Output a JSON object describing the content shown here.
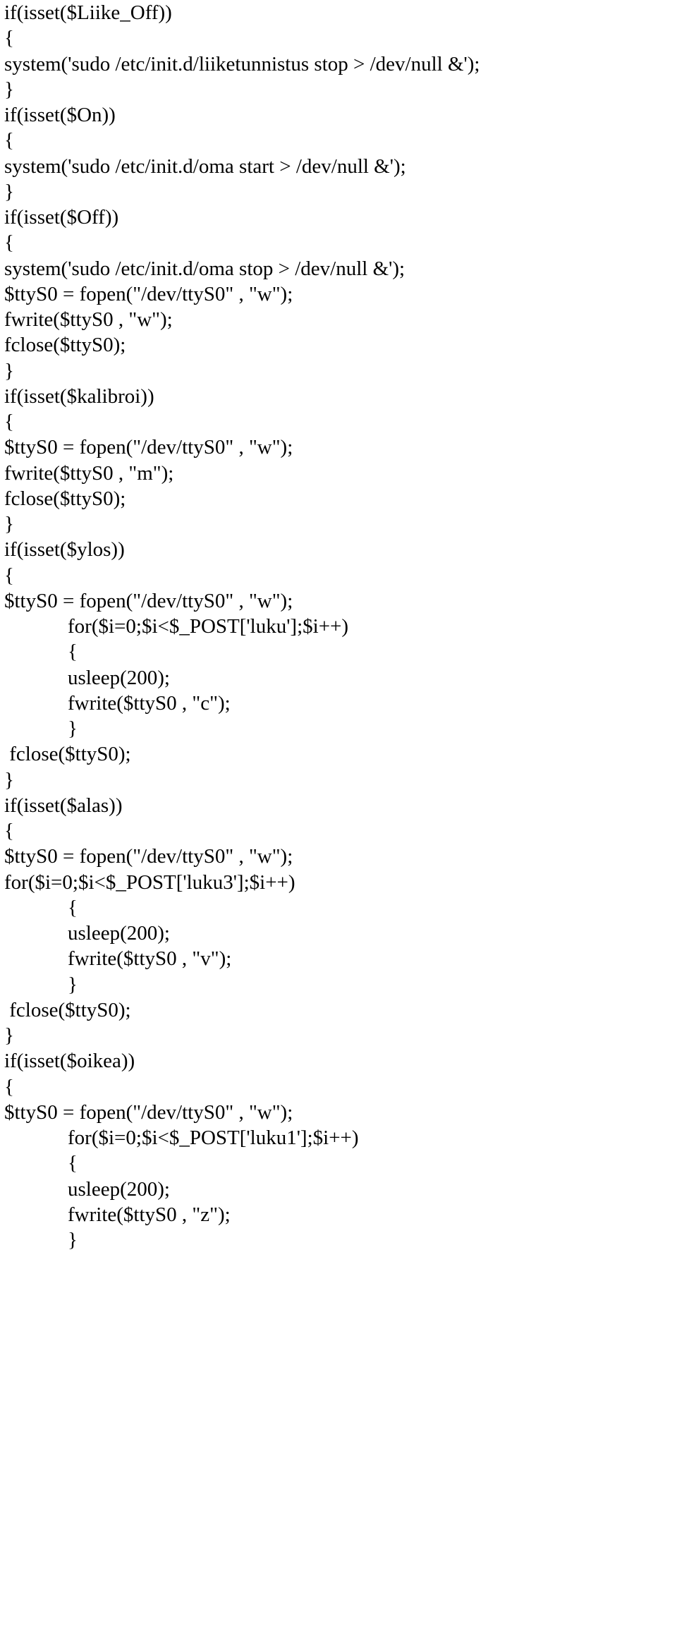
{
  "lines": [
    {
      "indent": 0,
      "text": "if(isset($Liike_Off))"
    },
    {
      "indent": 0,
      "text": "{"
    },
    {
      "indent": 0,
      "text": "system('sudo /etc/init.d/liiketunnistus stop > /dev/null &');"
    },
    {
      "indent": 0,
      "text": "}"
    },
    {
      "indent": 0,
      "text": "if(isset($On))"
    },
    {
      "indent": 0,
      "text": "{"
    },
    {
      "indent": 0,
      "text": "system('sudo /etc/init.d/oma start > /dev/null &');"
    },
    {
      "indent": 0,
      "text": "}"
    },
    {
      "indent": 0,
      "text": "if(isset($Off))"
    },
    {
      "indent": 0,
      "text": "{"
    },
    {
      "indent": 0,
      "text": "system('sudo /etc/init.d/oma stop > /dev/null &');"
    },
    {
      "indent": 0,
      "text": "$ttyS0 = fopen(\"/dev/ttyS0\" , \"w\");"
    },
    {
      "indent": 0,
      "text": "fwrite($ttyS0 , \"w\");"
    },
    {
      "indent": 0,
      "text": "fclose($ttyS0);"
    },
    {
      "indent": 0,
      "text": "}"
    },
    {
      "indent": 0,
      "text": "if(isset($kalibroi))"
    },
    {
      "indent": 0,
      "text": "{"
    },
    {
      "indent": 0,
      "text": "$ttyS0 = fopen(\"/dev/ttyS0\" , \"w\");"
    },
    {
      "indent": 0,
      "text": "fwrite($ttyS0 , \"m\");"
    },
    {
      "indent": 0,
      "text": "fclose($ttyS0);"
    },
    {
      "indent": 0,
      "text": "}"
    },
    {
      "indent": 0,
      "text": "if(isset($ylos))"
    },
    {
      "indent": 0,
      "text": "{"
    },
    {
      "indent": 0,
      "text": "$ttyS0 = fopen(\"/dev/ttyS0\" , \"w\");"
    },
    {
      "indent": 1,
      "text": "for($i=0;$i<$_POST['luku'];$i++)"
    },
    {
      "indent": 1,
      "text": "{"
    },
    {
      "indent": 1,
      "text": "usleep(200);"
    },
    {
      "indent": 1,
      "text": "fwrite($ttyS0 , \"c\");"
    },
    {
      "indent": 1,
      "text": "}"
    },
    {
      "indent": 0,
      "text": " fclose($ttyS0);"
    },
    {
      "indent": 0,
      "text": "}"
    },
    {
      "indent": 0,
      "text": "if(isset($alas))"
    },
    {
      "indent": 0,
      "text": "{"
    },
    {
      "indent": 0,
      "text": "$ttyS0 = fopen(\"/dev/ttyS0\" , \"w\");"
    },
    {
      "indent": 0,
      "text": "for($i=0;$i<$_POST['luku3'];$i++)"
    },
    {
      "indent": 1,
      "text": "{"
    },
    {
      "indent": 1,
      "text": "usleep(200);"
    },
    {
      "indent": 1,
      "text": "fwrite($ttyS0 , \"v\");"
    },
    {
      "indent": 1,
      "text": "}"
    },
    {
      "indent": 0,
      "text": " fclose($ttyS0);"
    },
    {
      "indent": 0,
      "text": "}"
    },
    {
      "indent": 0,
      "text": "if(isset($oikea))"
    },
    {
      "indent": 0,
      "text": "{"
    },
    {
      "indent": 0,
      "text": "$ttyS0 = fopen(\"/dev/ttyS0\" , \"w\");"
    },
    {
      "indent": 1,
      "text": "for($i=0;$i<$_POST['luku1'];$i++)"
    },
    {
      "indent": 1,
      "text": "{"
    },
    {
      "indent": 1,
      "text": "usleep(200);"
    },
    {
      "indent": 1,
      "text": "fwrite($ttyS0 , \"z\");"
    },
    {
      "indent": 1,
      "text": "}"
    }
  ]
}
